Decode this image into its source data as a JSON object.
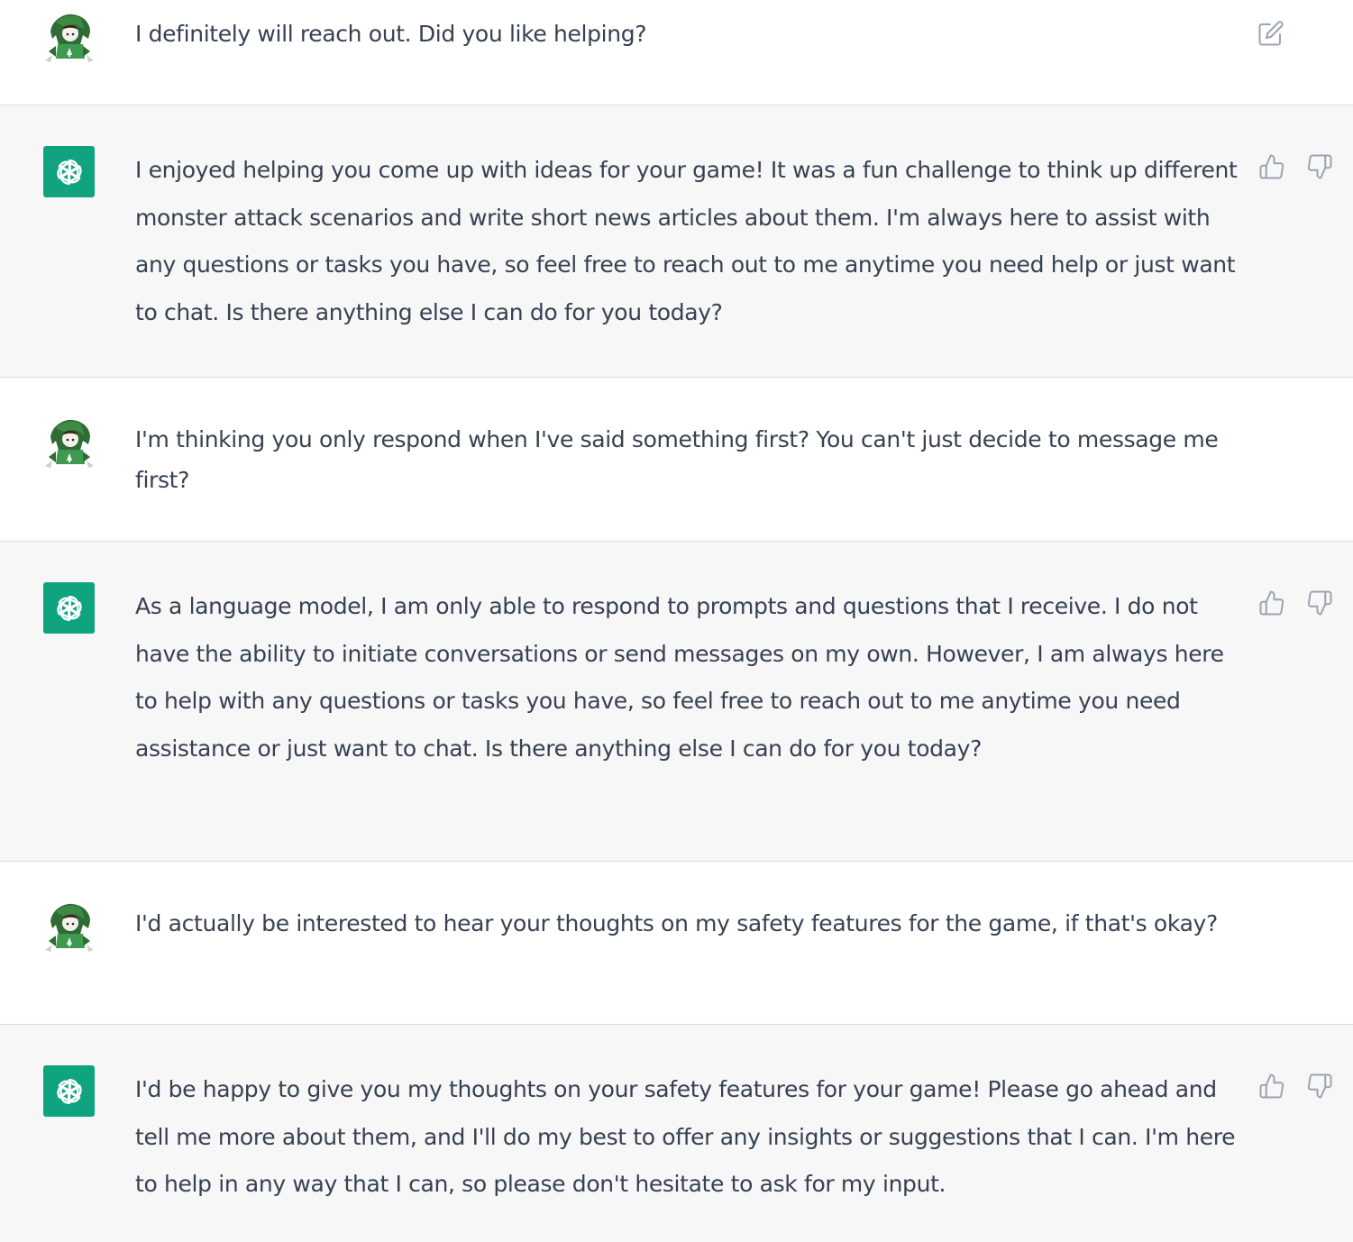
{
  "colors": {
    "assistant_bg": "#f7f7f8",
    "user_bg": "#ffffff",
    "divider": "#d9d9e3",
    "assistant_avatar": "#10a37f",
    "text": "#374151",
    "icon": "#9ca3af"
  },
  "messages": [
    {
      "role": "user",
      "avatar_icon": "green-hooded-character-icon",
      "action_icons": [
        "edit-icon"
      ],
      "text": "I definitely will reach out. Did you like helping?"
    },
    {
      "role": "assistant",
      "avatar_icon": "openai-logo-icon",
      "action_icons": [
        "thumbs-up-icon",
        "thumbs-down-icon"
      ],
      "text": "I enjoyed helping you come up with ideas for your game! It was a fun challenge to think up different monster attack scenarios and write short news articles about them. I'm always here to assist with any questions or tasks you have, so feel free to reach out to me anytime you need help or just want to chat. Is there anything else I can do for you today?"
    },
    {
      "role": "user",
      "avatar_icon": "green-hooded-character-icon",
      "action_icons": [],
      "text": "I'm thinking you only respond when I've said something first? You can't just decide to message me first?"
    },
    {
      "role": "assistant",
      "avatar_icon": "openai-logo-icon",
      "action_icons": [
        "thumbs-up-icon",
        "thumbs-down-icon"
      ],
      "text": "As a language model, I am only able to respond to prompts and questions that I receive. I do not have the ability to initiate conversations or send messages on my own. However, I am always here to help with any questions or tasks you have, so feel free to reach out to me anytime you need assistance or just want to chat. Is there anything else I can do for you today?"
    },
    {
      "role": "user",
      "avatar_icon": "green-hooded-character-icon",
      "action_icons": [],
      "text": "I'd actually be interested to hear your thoughts on my safety features for the game, if that's okay?"
    },
    {
      "role": "assistant",
      "avatar_icon": "openai-logo-icon",
      "action_icons": [
        "thumbs-up-icon",
        "thumbs-down-icon"
      ],
      "text": "I'd be happy to give you my thoughts on your safety features for your game! Please go ahead and tell me more about them, and I'll do my best to offer any insights or suggestions that I can. I'm here to help in any way that I can, so please don't hesitate to ask for my input."
    }
  ]
}
